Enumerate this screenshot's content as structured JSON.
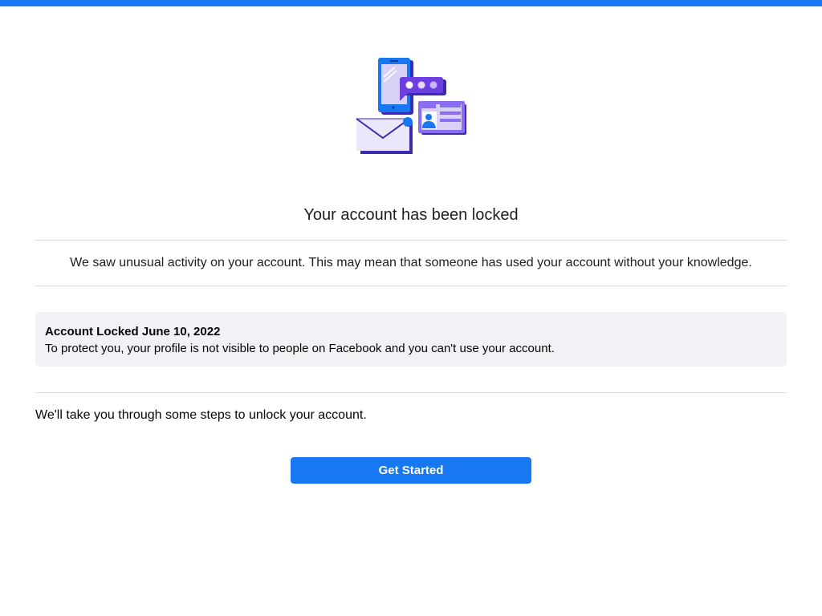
{
  "header": {
    "accent_color": "#1877f2"
  },
  "illustration": {
    "icon": "account-locked-illustration"
  },
  "main": {
    "title": "Your account has been locked",
    "description": "We saw unusual activity on your account. This may mean that someone has used your account without your knowledge.",
    "notice": {
      "title": "Account Locked June 10, 2022",
      "body": "To protect you, your profile is not visible to people on Facebook and you can't use your account."
    },
    "steps_text": "We'll take you through some steps to unlock your account.",
    "cta_label": "Get Started"
  }
}
